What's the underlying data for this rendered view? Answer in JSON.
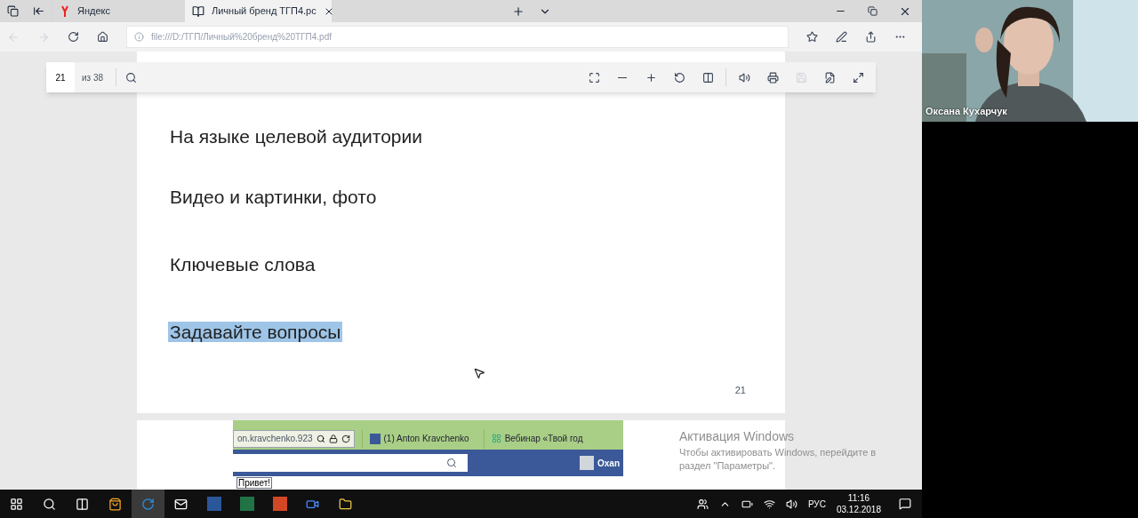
{
  "browser": {
    "tabs": [
      {
        "kind": "site",
        "label": "Яндекс",
        "selected": false
      },
      {
        "kind": "pdf",
        "label": "Личный бренд ТГП4.pc",
        "selected": true
      }
    ],
    "address": "file:///D:/ТГП/Личный%20бренд%20ТГП4.pdf"
  },
  "pdf_toolbar": {
    "page": "21",
    "total": "из 38"
  },
  "page": {
    "lines": [
      {
        "text": "На языке целевой аудитории",
        "selected": false
      },
      {
        "text": "Видео и картинки, фото",
        "selected": false
      },
      {
        "text": "Ключевые слова",
        "selected": false
      },
      {
        "text": "Задавайте вопросы",
        "selected": true
      }
    ],
    "number": "21"
  },
  "next_page": {
    "url": "on.kravchenko.923",
    "tabs": [
      "(1) Anton Kravchenko",
      "Вебинар «Твой год"
    ],
    "user": "Oxan",
    "greeting": "Привет!"
  },
  "activation": {
    "title": "Активация Windows",
    "text": "Чтобы активировать Windows, перейдите в раздел \"Параметры\"."
  },
  "taskbar": {
    "language": "РУС",
    "time": "11:16",
    "date": "03.12.2018"
  },
  "webcam": {
    "name": "Оксана Кухарчук"
  }
}
